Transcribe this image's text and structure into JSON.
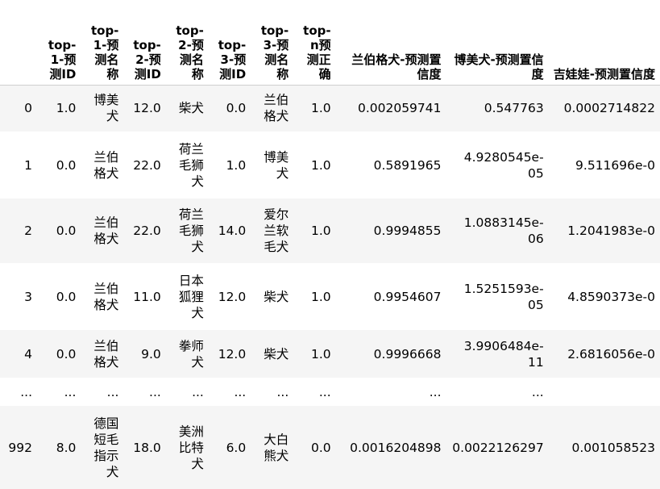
{
  "table": {
    "columns": [
      "",
      "top-1-预测ID",
      "top-1-预测名称",
      "top-2-预测ID",
      "top-2-预测名称",
      "top-3-预测ID",
      "top-3-预测名称",
      "top-n预测正确",
      "兰伯格犬-预测置信度",
      "博美犬-预测置信度",
      "吉娃娃-预测置信度"
    ],
    "rows": [
      [
        "0",
        "1.0",
        "博美犬",
        "12.0",
        "柴犬",
        "0.0",
        "兰伯格犬",
        "1.0",
        "0.002059741",
        "0.547763",
        "0.0002714822"
      ],
      [
        "1",
        "0.0",
        "兰伯格犬",
        "22.0",
        "荷兰毛狮犬",
        "1.0",
        "博美犬",
        "1.0",
        "0.5891965",
        "4.9280545e-05",
        "9.511696e-0"
      ],
      [
        "2",
        "0.0",
        "兰伯格犬",
        "22.0",
        "荷兰毛狮犬",
        "14.0",
        "爱尔兰软毛犬",
        "1.0",
        "0.9994855",
        "1.0883145e-06",
        "1.2041983e-0"
      ],
      [
        "3",
        "0.0",
        "兰伯格犬",
        "11.0",
        "日本狐狸犬",
        "12.0",
        "柴犬",
        "1.0",
        "0.9954607",
        "1.5251593e-05",
        "4.8590373e-0"
      ],
      [
        "4",
        "0.0",
        "兰伯格犬",
        "9.0",
        "拳师犬",
        "12.0",
        "柴犬",
        "1.0",
        "0.9996668",
        "3.9906484e-11",
        "2.6816056e-0"
      ],
      [
        "...",
        "...",
        "...",
        "...",
        "...",
        "...",
        "...",
        "...",
        "...",
        "...",
        ""
      ],
      [
        "992",
        "8.0",
        "德国短毛指示犬",
        "18.0",
        "美洲比特犬",
        "6.0",
        "大白熊犬",
        "0.0",
        "0.0016204898",
        "0.0022126297",
        "0.001058523"
      ]
    ]
  }
}
